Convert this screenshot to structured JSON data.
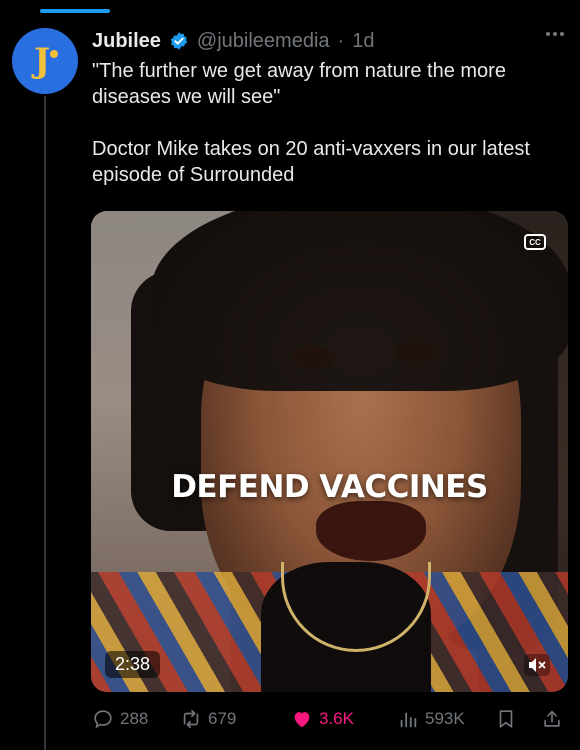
{
  "author": {
    "name": "Jubilee",
    "handle": "@jubileemedia",
    "separator": "·",
    "time": "1d",
    "verified_color": "#1d9bf0",
    "avatar_color": "#2a6fe0",
    "avatar_glyph": "J"
  },
  "tweet": {
    "line1": "\"The further we get away from nature the more diseases we will see\"",
    "line2": "Doctor Mike takes on 20 anti-vaxxers in our latest episode of Surrounded"
  },
  "media": {
    "caption": "DEFEND VACCINES",
    "cc_label": "CC",
    "duration": "2:38"
  },
  "actions": {
    "replies": "288",
    "reposts": "679",
    "likes": "3.6K",
    "views": "593K",
    "like_color": "#f91880"
  },
  "icons": [
    "verified-badge-icon",
    "more-icon",
    "cc-icon",
    "mute-icon",
    "reply-icon",
    "repost-icon",
    "like-icon",
    "views-icon",
    "bookmark-icon",
    "share-icon"
  ]
}
